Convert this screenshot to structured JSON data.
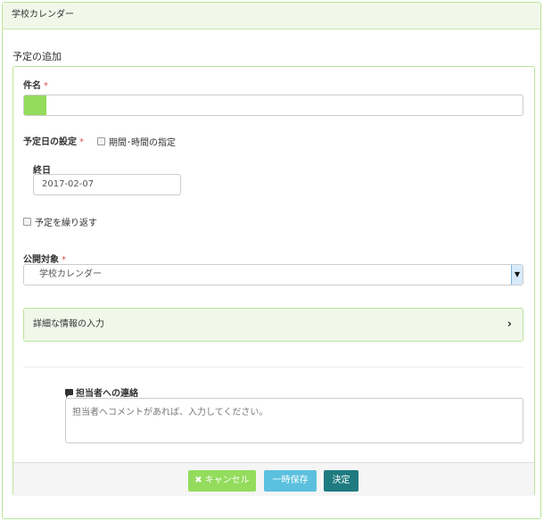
{
  "panel": {
    "title": "学校カレンダー"
  },
  "form": {
    "section_title": "予定の追加",
    "subject": {
      "label": "件名",
      "required_mark": "*",
      "fill_percent": 4.5
    },
    "date_setting": {
      "label": "予定日の設定",
      "required_mark": "*",
      "period_checkbox_label": "期間･時間の指定"
    },
    "end_date": {
      "label": "終日",
      "value": "2017-02-07"
    },
    "repeat": {
      "checkbox_label": "予定を繰り返す"
    },
    "audience": {
      "label": "公開対象",
      "required_mark": "*",
      "selected": "学校カレンダー"
    },
    "details": {
      "label": "詳細な情報の入力"
    },
    "contact": {
      "label": "担当者への連絡",
      "placeholder": "担当者へコメントがあれば、入力してください。"
    }
  },
  "buttons": {
    "cancel": "キャンセル",
    "cancel_icon": "✖",
    "draft": "一時保存",
    "submit": "決定"
  },
  "colors": {
    "accent_green": "#93dc5c",
    "info_blue": "#5bc0de",
    "primary_teal": "#1f7b80",
    "required_red": "#d9534f"
  }
}
